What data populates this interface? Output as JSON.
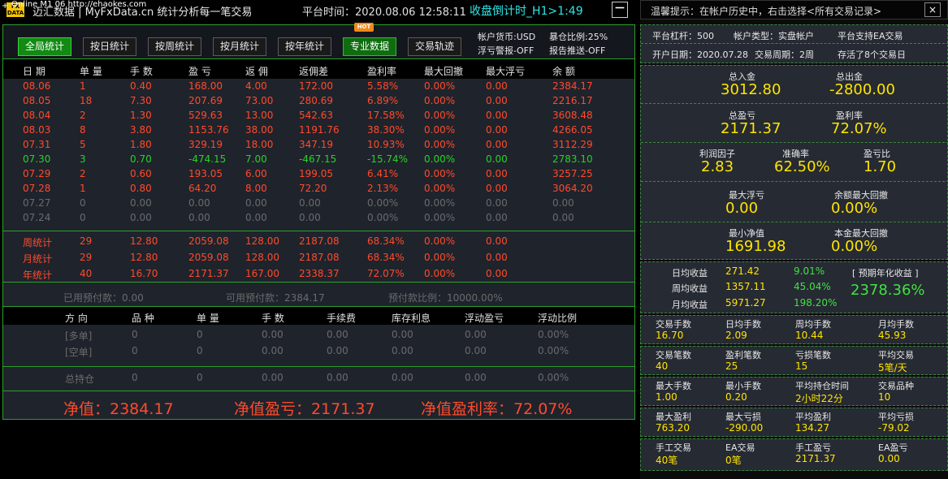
{
  "title": {
    "logo": "FX DATA",
    "app_name": "迈汇数据 | MyFxData.cn 统计分析每一笔交易",
    "overlay_text": "Online M1 06 http://ehaokes.com",
    "server_time": "平台时间：2020.08.06 12:58:11",
    "countdown": "收盘倒计时_H1>1:49",
    "minimize": "－"
  },
  "toolbar": {
    "buttons": [
      "全局统计",
      "按日统计",
      "按周统计",
      "按月统计",
      "按年统计",
      "专业数据",
      "交易轨迹"
    ],
    "hot_badge": "HOT",
    "currency": "帐户货币:USD",
    "position_ratio": "暴仓比例:25%",
    "float_alert": "浮亏警报-OFF",
    "report_push": "报告推送-OFF"
  },
  "daily_table": {
    "headers": [
      "日 期",
      "单 量",
      "手 数",
      "盈 亏",
      "返 佣",
      "返佣差",
      "盈利率",
      "最大回撤",
      "最大浮亏",
      "余 额"
    ],
    "rows": [
      {
        "c": [
          "08.06",
          "1",
          "0.40",
          "168.00",
          "4.00",
          "172.00",
          "5.58%",
          "0.00%",
          "0.00",
          "2384.17"
        ],
        "s": "red"
      },
      {
        "c": [
          "08.05",
          "18",
          "7.30",
          "207.69",
          "73.00",
          "280.69",
          "6.89%",
          "0.00%",
          "0.00",
          "2216.17"
        ],
        "s": "red"
      },
      {
        "c": [
          "08.04",
          "2",
          "1.30",
          "529.63",
          "13.00",
          "542.63",
          "17.58%",
          "0.00%",
          "0.00",
          "3608.48"
        ],
        "s": "red"
      },
      {
        "c": [
          "08.03",
          "8",
          "3.80",
          "1153.76",
          "38.00",
          "1191.76",
          "38.30%",
          "0.00%",
          "0.00",
          "4266.05"
        ],
        "s": "red"
      },
      {
        "c": [
          "07.31",
          "5",
          "1.80",
          "329.19",
          "18.00",
          "347.19",
          "10.93%",
          "0.00%",
          "0.00",
          "3112.29"
        ],
        "s": "red"
      },
      {
        "c": [
          "07.30",
          "3",
          "0.70",
          "-474.15",
          "7.00",
          "-467.15",
          "-15.74%",
          "0.00%",
          "0.00",
          "2783.10"
        ],
        "s": "green"
      },
      {
        "c": [
          "07.29",
          "2",
          "0.60",
          "193.05",
          "6.00",
          "199.05",
          "6.41%",
          "0.00%",
          "0.00",
          "3257.25"
        ],
        "s": "red"
      },
      {
        "c": [
          "07.28",
          "1",
          "0.80",
          "64.20",
          "8.00",
          "72.20",
          "2.13%",
          "0.00%",
          "0.00",
          "3064.20"
        ],
        "s": "red"
      },
      {
        "c": [
          "07.27",
          "0",
          "0.00",
          "0.00",
          "0.00",
          "0.00",
          "0.00%",
          "0.00%",
          "0.00",
          "0.00"
        ],
        "s": "gray"
      },
      {
        "c": [
          "07.24",
          "0",
          "0.00",
          "0.00",
          "0.00",
          "0.00",
          "0.00%",
          "0.00%",
          "0.00",
          "0.00"
        ],
        "s": "gray"
      }
    ],
    "summary": [
      {
        "c": [
          "周统计",
          "29",
          "12.80",
          "2059.08",
          "128.00",
          "2187.08",
          "68.34%",
          "0.00%",
          "0.00",
          ""
        ]
      },
      {
        "c": [
          "月统计",
          "29",
          "12.80",
          "2059.08",
          "128.00",
          "2187.08",
          "68.34%",
          "0.00%",
          "0.00",
          ""
        ]
      },
      {
        "c": [
          "年统计",
          "40",
          "16.70",
          "2171.37",
          "167.00",
          "2338.37",
          "72.07%",
          "0.00%",
          "0.00",
          ""
        ]
      }
    ]
  },
  "prepayment": {
    "used": "已用预付款：0.00",
    "available": "可用预付款：2384.17",
    "ratio": "预付款比例：10000.00%"
  },
  "orders_table": {
    "headers": [
      "方 向",
      "品 种",
      "单 量",
      "手 数",
      "手续费",
      "库存利息",
      "浮动盈亏",
      "浮动比例"
    ],
    "rows": [
      {
        "c": [
          "[多单]",
          "0",
          "0",
          "0.00",
          "0.00",
          "0.00",
          "0.00",
          "0.00%"
        ]
      },
      {
        "c": [
          "[空单]",
          "0",
          "0",
          "0.00",
          "0.00",
          "0.00",
          "0.00",
          "0.00%"
        ]
      }
    ],
    "total": {
      "c": [
        "总持仓",
        "0",
        "0",
        "0.00",
        "0.00",
        "0.00",
        "0.00",
        "0.00%"
      ]
    }
  },
  "net": {
    "equity": "净值：2384.17",
    "equity_pl": "净值盈亏：2171.37",
    "equity_rate": "净值盈利率：72.07%"
  },
  "right": {
    "tip": "温馨提示：在帐户历史中，右击选择<所有交易记录>",
    "close": "×",
    "info": {
      "leverage": "平台杠杆：500",
      "account_type": "帐户类型：实盘帐户",
      "ea": "平台支持EA交易",
      "open_date": "开户日期：2020.07.28",
      "trade_period": "交易周期：2周",
      "survival": "存活了8个交易日"
    },
    "big": {
      "deposit_label": "总入金",
      "deposit": "3012.80",
      "withdraw_label": "总出金",
      "withdraw": "-2800.00",
      "total_pl_label": "总盈亏",
      "total_pl": "2171.37",
      "profit_rate_label": "盈利率",
      "profit_rate": "72.07%",
      "profit_factor_label": "利润因子",
      "profit_factor": "2.83",
      "accuracy_label": "准确率",
      "accuracy": "62.50%",
      "pl_ratio_label": "盈亏比",
      "pl_ratio": "1.70",
      "max_float_label": "最大浮亏",
      "max_float": "0.00",
      "max_dd_label": "余额最大回撤",
      "max_dd": "0.00%",
      "min_equity_label": "最小净值",
      "min_equity": "1691.98",
      "principal_dd_label": "本金最大回撤",
      "principal_dd": "0.00%"
    },
    "returns": {
      "daily_label": "日均收益",
      "daily": "271.42",
      "daily_pct": "9.01%",
      "weekly_label": "周均收益",
      "weekly": "1357.11",
      "weekly_pct": "45.04%",
      "monthly_label": "月均收益",
      "monthly": "5971.27",
      "monthly_pct": "198.20%",
      "annual_label": "[ 预期年化收益 ]",
      "annual": "2378.36%"
    },
    "stats": [
      [
        {
          "l": "交易手数",
          "v": "16.70"
        },
        {
          "l": "日均手数",
          "v": "2.09"
        },
        {
          "l": "周均手数",
          "v": "10.44"
        },
        {
          "l": "月均手数",
          "v": "45.93"
        }
      ],
      [
        {
          "l": "交易笔数",
          "v": "40"
        },
        {
          "l": "盈利笔数",
          "v": "25"
        },
        {
          "l": "亏损笔数",
          "v": "15"
        },
        {
          "l": "平均交易",
          "v": "5笔/天"
        }
      ],
      [
        {
          "l": "最大手数",
          "v": "1.00"
        },
        {
          "l": "最小手数",
          "v": "0.20"
        },
        {
          "l": "平均持仓时间",
          "v": "2小时22分"
        },
        {
          "l": "交易品种",
          "v": "10"
        }
      ],
      [
        {
          "l": "最大盈利",
          "v": "763.20"
        },
        {
          "l": "最大亏损",
          "v": "-290.00"
        },
        {
          "l": "平均盈利",
          "v": "134.27"
        },
        {
          "l": "平均亏损",
          "v": "-79.02"
        }
      ],
      [
        {
          "l": "手工交易",
          "v": "40笔"
        },
        {
          "l": "EA交易",
          "v": "0笔"
        },
        {
          "l": "手工盈亏",
          "v": "2171.37"
        },
        {
          "l": "EA盈亏",
          "v": "0.00"
        }
      ]
    ]
  },
  "colors": {
    "accent_green": "#2e9e2e",
    "loss_red": "#ff4b2b",
    "profit_green": "#28d228",
    "highlight_yellow": "#ffe400",
    "countdown_cyan": "#2ee6e6"
  }
}
